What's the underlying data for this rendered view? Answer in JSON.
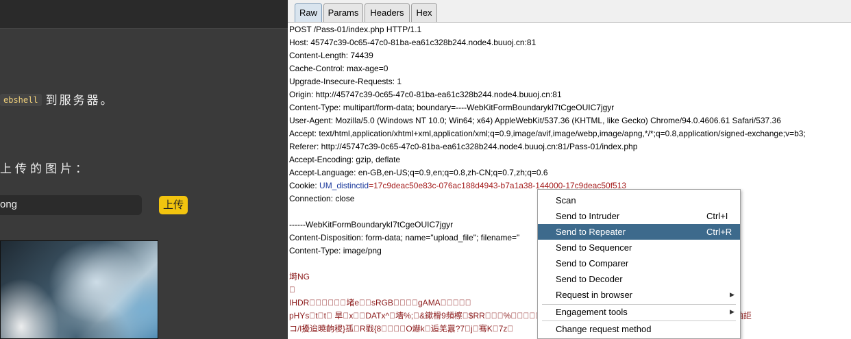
{
  "left": {
    "code_text": "ebshell",
    "text1_tail": "到服务器。",
    "text2": "上传的图片：",
    "file_value": "ong",
    "upload_label": "上传"
  },
  "tabs": [
    "Raw",
    "Params",
    "Headers",
    "Hex"
  ],
  "active_tab": "Raw",
  "request": {
    "lines": [
      "POST /Pass-01/index.php HTTP/1.1",
      "Host: 45747c39-0c65-47c0-81ba-ea61c328b244.node4.buuoj.cn:81",
      "Content-Length: 74439",
      "Cache-Control: max-age=0",
      "Upgrade-Insecure-Requests: 1",
      "Origin: http://45747c39-0c65-47c0-81ba-ea61c328b244.node4.buuoj.cn:81",
      "Content-Type: multipart/form-data; boundary=----WebKitFormBoundarykI7tCgeOUIC7jgyr",
      "User-Agent: Mozilla/5.0 (Windows NT 10.0; Win64; x64) AppleWebKit/537.36 (KHTML, like Gecko) Chrome/94.0.4606.61 Safari/537.36",
      "Accept: text/html,application/xhtml+xml,application/xml;q=0.9,image/avif,image/webp,image/apng,*/*;q=0.8,application/signed-exchange;v=b3;",
      "Referer: http://45747c39-0c65-47c0-81ba-ea61c328b244.node4.buuoj.cn:81/Pass-01/index.php",
      "Accept-Encoding: gzip, deflate",
      "Accept-Language: en-GB,en-US;q=0.9,en;q=0.8,zh-CN;q=0.7,zh;q=0.6"
    ],
    "cookie_prefix": "Cookie: ",
    "cookie_name": "UM_distinctid",
    "cookie_value": "=17c9deac50e83c-076ac188d4943-b7a1a38-144000-17c9deac50f513",
    "connection": "Connection: close",
    "boundary_line": "------WebKitFormBoundarykI7tCgeOUIC7jgyr",
    "disposition": "Content-Disposition: form-data; name=\"upload_file\"; filename=\"",
    "ctype": "Content-Type: image/png",
    "binary_lines": [
      "塒NG",
      "\u0000",
      "IHDR\u0000\u0000\u0000\u0000\u0000\u0000堵e\u0000\u0000sRGB\u0000\u0000\u0000\u0000gAMA\u0000\u0000\u0000\u0000\u0000",
      "pHYs\u0000t\u0000t\u0000 旱\u0000x\u0000\u0000DATx^\u0000墻%;\u0000&鏉榾9頻檫\u0000$RR\u0000\u0000\u0000%\u0000\u0000\u0000\u0000\u0000\u0000\u0000\u0000\u0000\u0000\u0000\u0000\u0000\u0000\u0000\u0000\u0000\u0000\u0000\u0000\u0000 \u0000鋸滻p棗\u0000-t>\u0000脘嚣i嘤\u0000/鲉詎",
      "コ/l擾迨曉齣稷}孤\u0000R戥{8\u0000\u0000\u0000\u0000O爀k\u0000逅羌囂?7\u0000j\u0000骞K\u00007z\u0000"
    ]
  },
  "menu": {
    "items": [
      {
        "label": "Scan",
        "shortcut": "",
        "submenu": false
      },
      {
        "label": "Send to Intruder",
        "shortcut": "Ctrl+I",
        "submenu": false
      },
      {
        "label": "Send to Repeater",
        "shortcut": "Ctrl+R",
        "submenu": false,
        "highlighted": true
      },
      {
        "label": "Send to Sequencer",
        "shortcut": "",
        "submenu": false
      },
      {
        "label": "Send to Comparer",
        "shortcut": "",
        "submenu": false
      },
      {
        "label": "Send to Decoder",
        "shortcut": "",
        "submenu": false
      },
      {
        "label": "Request in browser",
        "shortcut": "",
        "submenu": true
      },
      {
        "label": "Engagement tools",
        "shortcut": "",
        "submenu": true
      },
      {
        "label": "Change request method",
        "shortcut": "",
        "submenu": false
      }
    ]
  }
}
